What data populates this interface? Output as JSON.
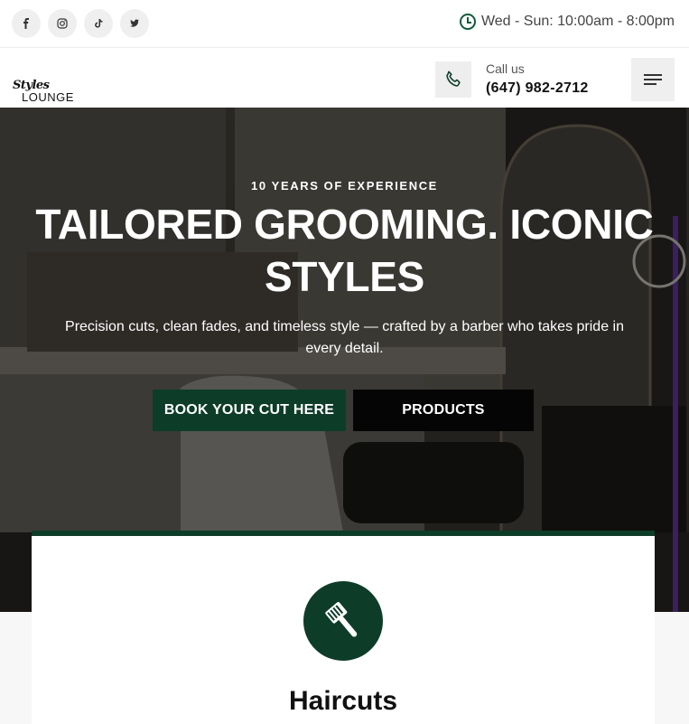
{
  "topbar": {
    "social": [
      {
        "name": "facebook-icon",
        "glyph": "f"
      },
      {
        "name": "instagram-icon",
        "glyph": "◎"
      },
      {
        "name": "tiktok-icon",
        "glyph": "♪"
      },
      {
        "name": "twitter-icon",
        "glyph": "🐦"
      }
    ],
    "hours": "Wed - Sun: 10:00am - 8:00pm"
  },
  "header": {
    "logo_script": "Styles",
    "logo_word": "LOUNGE",
    "call_label": "Call us",
    "call_number": "(647) 982-2712"
  },
  "hero": {
    "eyebrow": "10 YEARS OF EXPERIENCE",
    "headline_line1": "TAILORED GROOMING. ICONIC",
    "headline_line2": "STYLES",
    "subtext": "Precision cuts, clean fades, and timeless style — crafted by a barber who takes pride in every detail.",
    "book_label": "BOOK YOUR CUT HERE",
    "products_label": "PRODUCTS"
  },
  "service_card": {
    "title": "Haircuts",
    "icon": "comb-icon"
  },
  "colors": {
    "brand_green": "#0d3d29",
    "clock_green": "#0f5a3a",
    "dark": "#050505"
  }
}
